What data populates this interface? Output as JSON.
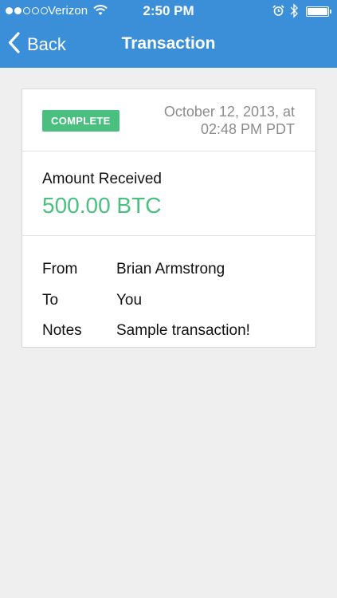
{
  "status_bar": {
    "carrier": "Verizon",
    "time": "2:50 PM",
    "signal_bars": 2,
    "signal_max": 5
  },
  "nav": {
    "back_label": "Back",
    "title": "Transaction"
  },
  "transaction": {
    "status": "COMPLETE",
    "date_line1": "October 12, 2013, at",
    "date_line2": "02:48 PM PDT",
    "amount_label": "Amount Received",
    "amount_value": "500.00 BTC",
    "details": [
      {
        "key": "From",
        "value": "Brian Armstrong"
      },
      {
        "key": "To",
        "value": "You"
      },
      {
        "key": "Notes",
        "value": "Sample transaction!"
      }
    ]
  },
  "colors": {
    "header": "#3b8fd9",
    "accent_green": "#4bbf80",
    "background": "#efefef"
  },
  "icons": [
    "signal-icon",
    "wifi-icon",
    "alarm-icon",
    "bluetooth-icon",
    "battery-icon",
    "chevron-left-icon"
  ]
}
